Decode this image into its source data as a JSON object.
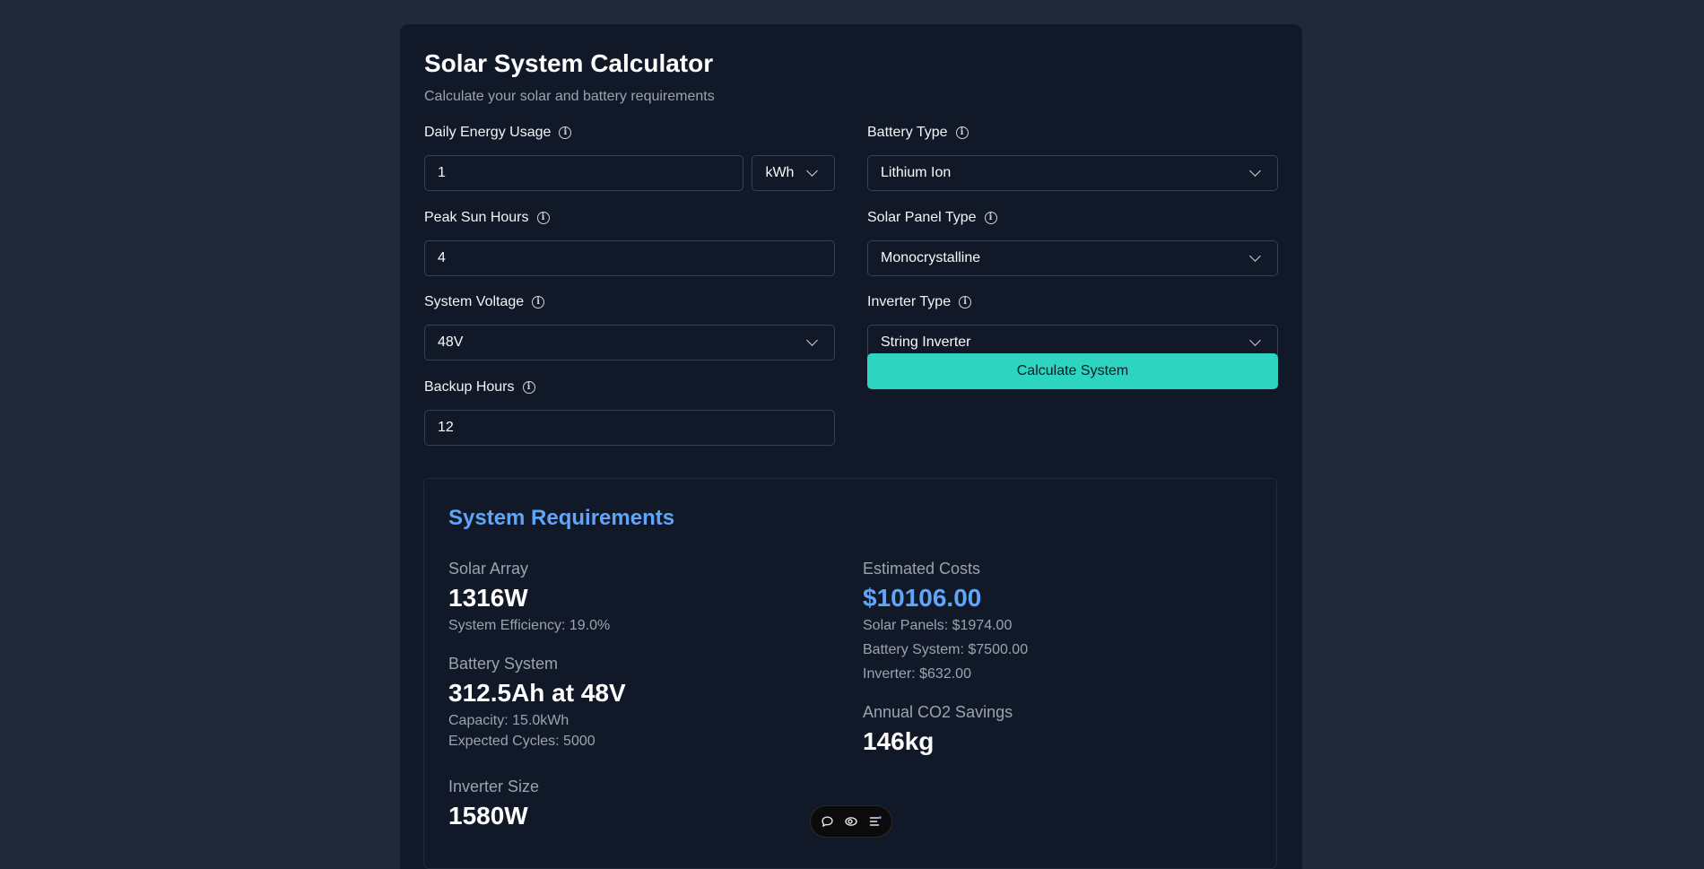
{
  "header": {
    "title": "Solar System Calculator",
    "subtitle": "Calculate your solar and battery requirements"
  },
  "form": {
    "daily_energy": {
      "label": "Daily Energy Usage",
      "value": "1",
      "unit": "kWh"
    },
    "peak_sun": {
      "label": "Peak Sun Hours",
      "value": "4"
    },
    "system_voltage": {
      "label": "System Voltage",
      "value": "48V"
    },
    "backup_hours": {
      "label": "Backup Hours",
      "value": "12"
    },
    "battery_type": {
      "label": "Battery Type",
      "value": "Lithium Ion"
    },
    "panel_type": {
      "label": "Solar Panel Type",
      "value": "Monocrystalline"
    },
    "inverter_type": {
      "label": "Inverter Type",
      "value": "String Inverter"
    },
    "calculate_label": "Calculate System"
  },
  "results": {
    "title": "System Requirements",
    "solar_array": {
      "label": "Solar Array",
      "value": "1316W",
      "efficiency": "System Efficiency: 19.0%"
    },
    "battery": {
      "label": "Battery System",
      "value": "312.5Ah at 48V",
      "capacity": "Capacity: 15.0kWh",
      "cycles": "Expected Cycles: 5000"
    },
    "inverter": {
      "label": "Inverter Size",
      "value": "1580W"
    },
    "costs": {
      "label": "Estimated Costs",
      "total": "$10106.00",
      "panels": "Solar Panels: $1974.00",
      "battery": "Battery System: $7500.00",
      "inverter": "Inverter: $632.00"
    },
    "co2": {
      "label": "Annual CO2 Savings",
      "value": "146kg"
    }
  },
  "colors": {
    "accent_teal": "#2dd4bf",
    "accent_blue": "#60a5fa",
    "page_bg": "#1f2937",
    "card_bg": "#111827"
  },
  "icons": [
    "info-icon",
    "chevron-down-icon",
    "chat-icon",
    "eye-icon",
    "list-icon"
  ]
}
